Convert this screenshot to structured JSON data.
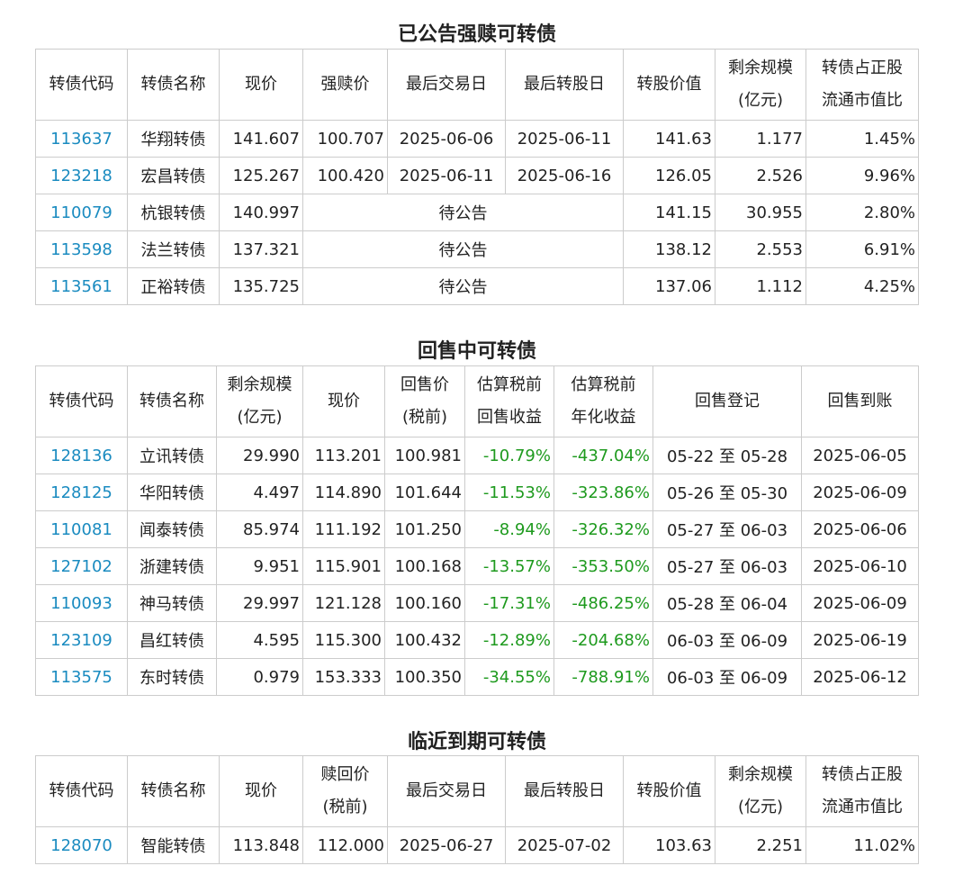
{
  "redeem": {
    "title": "已公告强赎可转债",
    "headers": [
      [
        "转债代码"
      ],
      [
        "转债名称"
      ],
      [
        "现价"
      ],
      [
        "强赎价"
      ],
      [
        "最后交易日"
      ],
      [
        "最后转股日"
      ],
      [
        "转股价值"
      ],
      [
        "剩余规模",
        "(亿元)"
      ],
      [
        "转债占正股",
        "流通市值比"
      ]
    ],
    "rows": [
      {
        "code": "113637",
        "name": "华翔转债",
        "price": "141.607",
        "redeem_price": "100.707",
        "last_trade": "2025-06-06",
        "last_convert": "2025-06-11",
        "conv_value": "141.63",
        "remaining": "1.177",
        "ratio": "1.45%"
      },
      {
        "code": "123218",
        "name": "宏昌转债",
        "price": "125.267",
        "redeem_price": "100.420",
        "last_trade": "2025-06-11",
        "last_convert": "2025-06-16",
        "conv_value": "126.05",
        "remaining": "2.526",
        "ratio": "9.96%"
      },
      {
        "code": "110079",
        "name": "杭银转债",
        "price": "140.997",
        "pending": "待公告",
        "conv_value": "141.15",
        "remaining": "30.955",
        "ratio": "2.80%"
      },
      {
        "code": "113598",
        "name": "法兰转债",
        "price": "137.321",
        "pending": "待公告",
        "conv_value": "138.12",
        "remaining": "2.553",
        "ratio": "6.91%"
      },
      {
        "code": "113561",
        "name": "正裕转债",
        "price": "135.725",
        "pending": "待公告",
        "conv_value": "137.06",
        "remaining": "1.112",
        "ratio": "4.25%"
      }
    ]
  },
  "putback": {
    "title": "回售中可转债",
    "headers": [
      [
        "转债代码"
      ],
      [
        "转债名称"
      ],
      [
        "剩余规模",
        "(亿元)"
      ],
      [
        "现价"
      ],
      [
        "回售价",
        "(税前)"
      ],
      [
        "估算税前",
        "回售收益"
      ],
      [
        "估算税前",
        "年化收益"
      ],
      [
        "回售登记"
      ],
      [
        "回售到账"
      ]
    ],
    "rows": [
      {
        "code": "128136",
        "name": "立讯转债",
        "remaining": "29.990",
        "price": "113.201",
        "put_price": "100.981",
        "yield": "-10.79%",
        "annual": "-437.04%",
        "register": "05-22 至 05-28",
        "arrival": "2025-06-05"
      },
      {
        "code": "128125",
        "name": "华阳转债",
        "remaining": "4.497",
        "price": "114.890",
        "put_price": "101.644",
        "yield": "-11.53%",
        "annual": "-323.86%",
        "register": "05-26 至 05-30",
        "arrival": "2025-06-09"
      },
      {
        "code": "110081",
        "name": "闻泰转债",
        "remaining": "85.974",
        "price": "111.192",
        "put_price": "101.250",
        "yield": "-8.94%",
        "annual": "-326.32%",
        "register": "05-27 至 06-03",
        "arrival": "2025-06-06"
      },
      {
        "code": "127102",
        "name": "浙建转债",
        "remaining": "9.951",
        "price": "115.901",
        "put_price": "100.168",
        "yield": "-13.57%",
        "annual": "-353.50%",
        "register": "05-27 至 06-03",
        "arrival": "2025-06-10"
      },
      {
        "code": "110093",
        "name": "神马转债",
        "remaining": "29.997",
        "price": "121.128",
        "put_price": "100.160",
        "yield": "-17.31%",
        "annual": "-486.25%",
        "register": "05-28 至 06-04",
        "arrival": "2025-06-09"
      },
      {
        "code": "123109",
        "name": "昌红转债",
        "remaining": "4.595",
        "price": "115.300",
        "put_price": "100.432",
        "yield": "-12.89%",
        "annual": "-204.68%",
        "register": "06-03 至 06-09",
        "arrival": "2025-06-19"
      },
      {
        "code": "113575",
        "name": "东时转债",
        "remaining": "0.979",
        "price": "153.333",
        "put_price": "100.350",
        "yield": "-34.55%",
        "annual": "-788.91%",
        "register": "06-03 至 06-09",
        "arrival": "2025-06-12"
      }
    ]
  },
  "maturity": {
    "title": "临近到期可转债",
    "headers": [
      [
        "转债代码"
      ],
      [
        "转债名称"
      ],
      [
        "现价"
      ],
      [
        "赎回价",
        "(税前)"
      ],
      [
        "最后交易日"
      ],
      [
        "最后转股日"
      ],
      [
        "转股价值"
      ],
      [
        "剩余规模",
        "(亿元)"
      ],
      [
        "转债占正股",
        "流通市值比"
      ]
    ],
    "rows": [
      {
        "code": "128070",
        "name": "智能转债",
        "price": "113.848",
        "redeem_price": "112.000",
        "last_trade": "2025-06-27",
        "last_convert": "2025-07-02",
        "conv_value": "103.63",
        "remaining": "2.251",
        "ratio": "11.02%"
      }
    ]
  },
  "colors": {
    "code_link": "#1a8bc0",
    "negative": "#1e9a1e",
    "border": "#cccccc"
  }
}
